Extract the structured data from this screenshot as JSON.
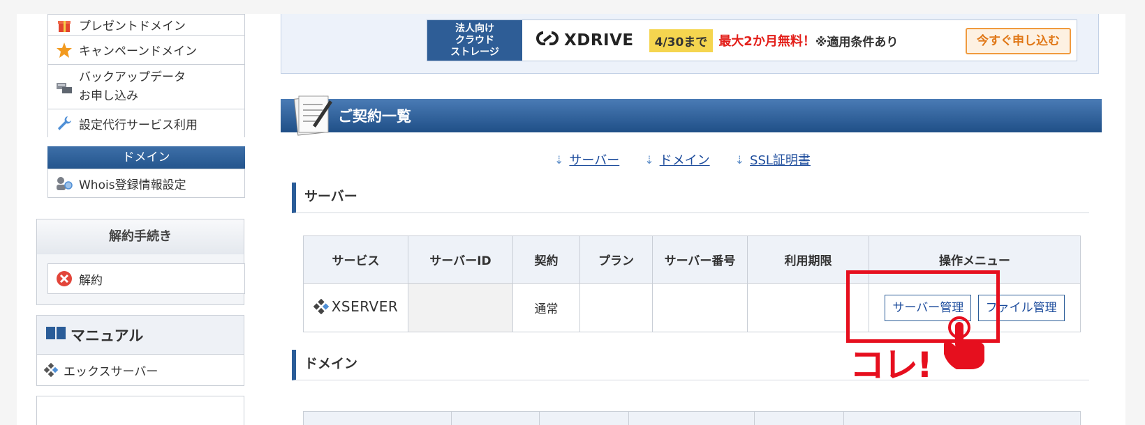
{
  "sidebar": {
    "menu_items": [
      {
        "label": "プレゼントドメイン",
        "icon": "gift-icon"
      },
      {
        "label": "キャンペーンドメイン",
        "icon": "star-icon"
      },
      {
        "label": "バックアップデータ\nお申し込み",
        "icon": "backup-icon"
      },
      {
        "label": "設定代行サービス利用",
        "icon": "wrench-icon"
      }
    ],
    "domain_head": "ドメイン",
    "domain_items": [
      {
        "label": "Whois登録情報設定",
        "icon": "user-search-icon"
      }
    ],
    "cancel_head": "解約手続き",
    "cancel_item": "解約",
    "manual_head": "マニュアル",
    "manual_item": "エックスサーバー"
  },
  "banner": {
    "tag": "法人向け\nクラウド\nストレージ",
    "brand": "XDRIVE",
    "date_badge": "4/30まで",
    "promo": "最大2か月無料！",
    "note": "※適用条件あり",
    "apply": "今すぐ申し込む"
  },
  "section": {
    "title": "ご契約一覧",
    "anchors": [
      "サーバー",
      "ドメイン",
      "SSL証明書"
    ]
  },
  "server": {
    "heading": "サーバー",
    "columns": [
      "サービス",
      "サーバーID",
      "契約",
      "プラン",
      "サーバー番号",
      "利用期限",
      "操作メニュー"
    ],
    "row": {
      "service": "XSERVER",
      "server_id": "",
      "contract": "通常",
      "plan": "",
      "number": "",
      "expiry": "",
      "btn_manage": "サーバー管理",
      "btn_file": "ファイル管理"
    }
  },
  "domain": {
    "heading": "ドメイン"
  },
  "annotation": {
    "text": "コレ!"
  },
  "colors": {
    "primary": "#2a5c98",
    "accent_red": "#e60f1e",
    "orange": "#f09a3e"
  }
}
